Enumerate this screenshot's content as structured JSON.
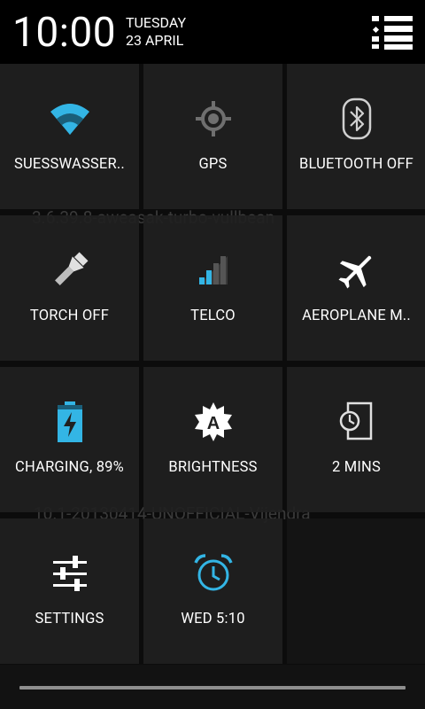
{
  "header": {
    "time": "10:00",
    "day": "TUESDAY",
    "date": "23 APRIL",
    "list_toggle_icon": "notification-list-icon"
  },
  "tiles": [
    {
      "label": "SUESSWASSER..",
      "icon": "wifi-icon",
      "color": "#33b5e5"
    },
    {
      "label": "GPS",
      "icon": "gps-icon",
      "color": "#6f6f6f"
    },
    {
      "label": "BLUETOOTH OFF",
      "icon": "bluetooth-icon",
      "color": "#d0d0d0"
    },
    {
      "label": "TORCH OFF",
      "icon": "torch-icon",
      "color": "#e0e0e0"
    },
    {
      "label": "TELCO",
      "icon": "signal-icon",
      "color": "#33b5e5"
    },
    {
      "label": "AEROPLANE M..",
      "icon": "airplane-icon",
      "color": "#ffffff"
    },
    {
      "label": "CHARGING, 89%",
      "icon": "battery-charging-icon",
      "color": "#33b5e5"
    },
    {
      "label": "BRIGHTNESS",
      "icon": "brightness-icon",
      "color": "#ffffff"
    },
    {
      "label": "2 MINS",
      "icon": "screen-timeout-icon",
      "color": "#e0e0e0"
    },
    {
      "label": "SETTINGS",
      "icon": "settings-sliders-icon",
      "color": "#ffffff"
    },
    {
      "label": "WED 5:10",
      "icon": "alarm-clock-icon",
      "color": "#33b5e5"
    }
  ],
  "background_text": [
    "3.6.39.8-aweasak-turbo-vullbean",
    "10.1-20130414-UNOFFICIAL-Vijendra"
  ]
}
